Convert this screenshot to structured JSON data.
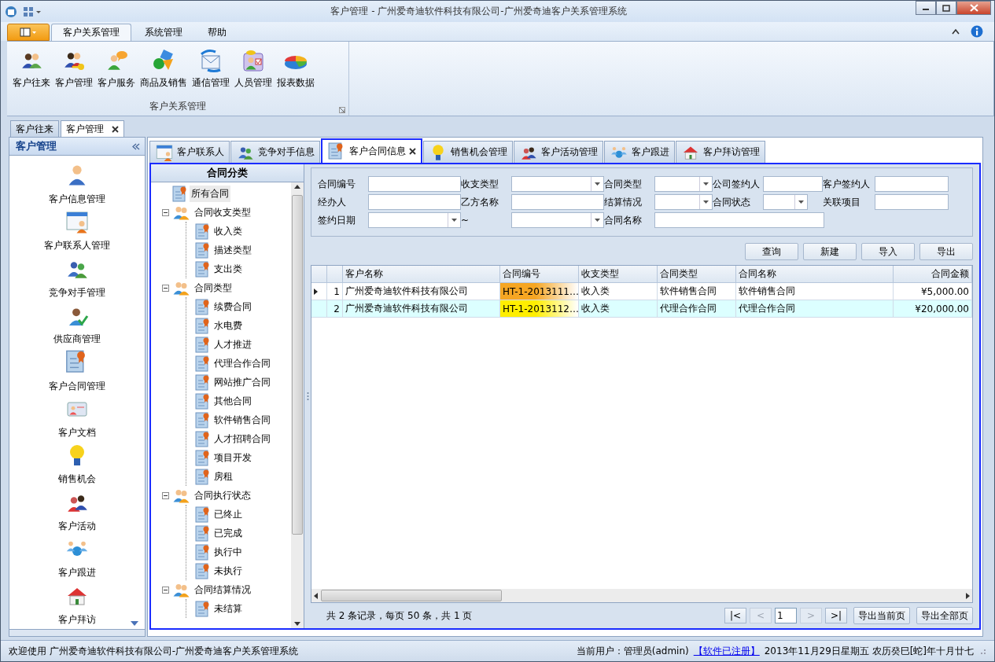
{
  "window": {
    "title": "客户管理 - 广州爱奇迪软件科技有限公司-广州爱奇迪客户关系管理系统"
  },
  "ribbon": {
    "tabs": [
      {
        "label": "客户关系管理",
        "selected": true
      },
      {
        "label": "系统管理",
        "selected": false
      },
      {
        "label": "帮助",
        "selected": false
      }
    ],
    "groups": [
      {
        "label": "客户关系管理",
        "buttons": [
          "客户往来",
          "客户管理",
          "客户服务",
          "商品及销售",
          "通信管理",
          "人员管理",
          "报表数据"
        ]
      }
    ]
  },
  "doc_tabs": [
    {
      "label": "客户往来",
      "selected": false,
      "closable": false
    },
    {
      "label": "客户管理",
      "selected": true,
      "closable": true
    }
  ],
  "nav": {
    "title": "客户管理",
    "items": [
      "客户信息管理",
      "客户联系人管理",
      "竞争对手管理",
      "供应商管理",
      "客户合同管理",
      "客户文档",
      "销售机会",
      "客户活动",
      "客户跟进",
      "客户拜访"
    ]
  },
  "content_tabs": [
    {
      "label": "客户联系人",
      "selected": false,
      "closable": false
    },
    {
      "label": "竞争对手信息",
      "selected": false,
      "closable": false
    },
    {
      "label": "客户合同信息",
      "selected": true,
      "closable": true
    },
    {
      "label": "销售机会管理",
      "selected": false,
      "closable": false
    },
    {
      "label": "客户活动管理",
      "selected": false,
      "closable": false
    },
    {
      "label": "客户跟进",
      "selected": false,
      "closable": false
    },
    {
      "label": "客户拜访管理",
      "selected": false,
      "closable": false
    }
  ],
  "tree": {
    "title": "合同分类",
    "items": [
      {
        "label": "所有合同",
        "selected": true
      },
      {
        "label": "合同收支类型",
        "selected": false,
        "expanded": true,
        "children": [
          {
            "label": "收入类",
            "selected": false
          },
          {
            "label": "描述类型",
            "selected": false
          },
          {
            "label": "支出类",
            "selected": false
          }
        ]
      },
      {
        "label": "合同类型",
        "selected": false,
        "expanded": true,
        "children": [
          {
            "label": "续费合同",
            "selected": false
          },
          {
            "label": "水电费",
            "selected": false
          },
          {
            "label": "人才推进",
            "selected": false
          },
          {
            "label": "代理合作合同",
            "selected": false
          },
          {
            "label": "网站推广合同",
            "selected": false
          },
          {
            "label": "其他合同",
            "selected": false
          },
          {
            "label": "软件销售合同",
            "selected": false
          },
          {
            "label": "人才招聘合同",
            "selected": false
          },
          {
            "label": "项目开发",
            "selected": false
          },
          {
            "label": "房租",
            "selected": false
          }
        ]
      },
      {
        "label": "合同执行状态",
        "selected": false,
        "expanded": true,
        "children": [
          {
            "label": "已终止",
            "selected": false
          },
          {
            "label": "已完成",
            "selected": false
          },
          {
            "label": "执行中",
            "selected": false
          },
          {
            "label": "未执行",
            "selected": false
          }
        ]
      },
      {
        "label": "合同结算情况",
        "selected": false,
        "expanded": true,
        "children": [
          {
            "label": "未结算",
            "selected": false
          }
        ]
      }
    ]
  },
  "filters": [
    [
      {
        "label": "合同编号",
        "kind": "text"
      },
      {
        "label": "收支类型",
        "kind": "combo"
      },
      {
        "label": "合同类型",
        "kind": "combo"
      },
      {
        "label": "公司签约人",
        "kind": "text"
      },
      {
        "label": "客户签约人",
        "kind": "text"
      }
    ],
    [
      {
        "label": "经办人",
        "kind": "text"
      },
      {
        "label": "乙方名称",
        "kind": "text"
      },
      {
        "label": "结算情况",
        "kind": "combo"
      },
      {
        "label": "合同状态",
        "kind": "combo"
      },
      {
        "label": "关联项目",
        "kind": "text"
      }
    ],
    [
      {
        "label": "签约日期",
        "kind": "combo"
      },
      {
        "label": "~",
        "kind": "combo"
      },
      {
        "label": "合同名称",
        "kind": "text"
      }
    ]
  ],
  "actions": [
    "查询",
    "新建",
    "导入",
    "导出"
  ],
  "table": {
    "columns": [
      "客户名称",
      "合同编号",
      "收支类型",
      "合同类型",
      "合同名称",
      "合同金额"
    ],
    "rows": [
      {
        "number": "1",
        "current": true,
        "color": "#f6a623",
        "cells": [
          "广州爱奇迪软件科技有限公司",
          "HT-1-2013111…",
          "收入类",
          "软件销售合同",
          "软件销售合同",
          "¥5,000.00"
        ]
      },
      {
        "number": "2",
        "current": false,
        "color": "#ffee00",
        "cells": [
          "广州爱奇迪软件科技有限公司",
          "HT-1-2013112…",
          "收入类",
          "代理合作合同",
          "代理合作合同",
          "¥20,000.00"
        ]
      }
    ]
  },
  "pager": {
    "summary": "共 2 条记录，每页 50 条，共 1 页",
    "buttons": [
      {
        "label": "|<",
        "disabled": false
      },
      {
        "label": "<",
        "disabled": true
      }
    ],
    "page": "1",
    "buttons_after": [
      {
        "label": ">",
        "disabled": true
      },
      {
        "label": ">|",
        "disabled": false
      }
    ],
    "exports": [
      "导出当前页",
      "导出全部页"
    ]
  },
  "status_bar": {
    "welcome": "欢迎使用 广州爱奇迪软件科技有限公司-广州爱奇迪客户关系管理系统",
    "user": "当前用户：管理员(admin)",
    "link": "【软件已注册】",
    "date": "2013年11月29日星期五 农历癸巳[蛇]年十月廿七"
  }
}
